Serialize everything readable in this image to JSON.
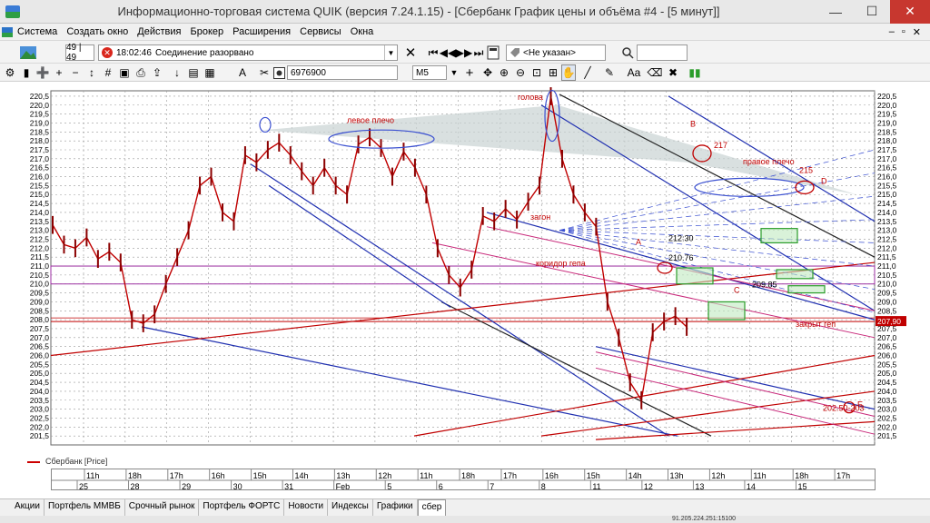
{
  "window": {
    "title": "Информационно-торговая система QUIK (версия 7.24.1.15) - [Сбербанк График цены и объёма #4 - [5 минут]]",
    "minimize": "—",
    "maximize": "☐",
    "close": "✕"
  },
  "menu": {
    "items": [
      "Система",
      "Создать окно",
      "Действия",
      "Брокер",
      "Расширения",
      "Сервисы",
      "Окна"
    ],
    "right": [
      "–",
      "▫",
      "✕"
    ]
  },
  "toolbar": {
    "counter": "49 | 49",
    "status_time": "18:02:46",
    "status_text": "Соединение разорвано",
    "close_symbol": "✕",
    "instrument_select": "<Не указан>",
    "security_code": "6976900",
    "timeframe": "M5"
  },
  "legend": {
    "label": "Сбербанк [Price]"
  },
  "chart_data": {
    "type": "candlestick",
    "title": "Сбербанк [Price]",
    "ylim": [
      201.0,
      220.8
    ],
    "y_ticks": [
      "220,5",
      "220,0",
      "219,5",
      "219,0",
      "218,5",
      "218,0",
      "217,5",
      "217,0",
      "216,5",
      "216,0",
      "215,5",
      "215,0",
      "214,5",
      "214,0",
      "213,5",
      "213,0",
      "212,5",
      "212,0",
      "211,5",
      "211,0",
      "210,5",
      "210,0",
      "209,5",
      "209,0",
      "208,5",
      "208,0",
      "207,5",
      "207,0",
      "206,5",
      "206,0",
      "205,5",
      "205,0",
      "204,5",
      "204,0",
      "203,5",
      "203,0",
      "202,5",
      "202,0",
      "201,5"
    ],
    "price_series": [
      [
        213.3,
        212.2,
        212.0,
        212.6,
        211.4,
        211.8,
        211.2,
        208.0,
        207.8,
        208.3,
        210.0,
        211.5,
        213.0,
        215.5,
        216.0,
        214.0,
        213.5,
        217.2,
        216.8,
        217.5,
        217.9,
        217.2,
        216.3,
        215.5,
        216.5,
        215.5,
        215.0,
        217.8,
        218.2,
        217.6,
        216.0,
        217.4,
        216.5,
        215.0,
        212.0,
        210.5,
        209.8,
        210.8,
        213.8,
        213.5,
        214.2,
        213.6,
        214.6,
        215.5,
        220.5,
        217.0,
        215.0,
        214.0,
        213.2,
        209.0,
        207.0,
        204.5,
        203.5,
        207.3,
        207.9,
        208.2,
        207.6
      ]
    ],
    "price_label_marker": "207,90",
    "time_row_1": [
      "11h",
      "18h",
      "17h",
      "16h",
      "15h",
      "14h",
      "13h",
      "12h",
      "11h",
      "18h",
      "17h",
      "16h",
      "15h",
      "14h",
      "13h",
      "12h",
      "11h",
      "18h",
      "17h"
    ],
    "time_row_2": [
      "25",
      "28",
      "29",
      "30",
      "31",
      "Feb",
      "5",
      "6",
      "7",
      "8",
      "11",
      "12",
      "13",
      "14",
      "15"
    ],
    "annotations": [
      {
        "text": "голова",
        "color": "#c00000"
      },
      {
        "text": "левое плечо",
        "color": "#c00000"
      },
      {
        "text": "правое плечо",
        "color": "#c00000"
      },
      {
        "text": "217",
        "color": "#c00000"
      },
      {
        "text": "215",
        "color": "#c00000"
      },
      {
        "text": "загон",
        "color": "#c00000"
      },
      {
        "text": "коридор гепа",
        "color": "#c00000"
      },
      {
        "text": "закрыт геп",
        "color": "#c00000"
      },
      {
        "text": "212:30",
        "color": "#000000"
      },
      {
        "text": "210.76",
        "color": "#000000"
      },
      {
        "text": "209.85",
        "color": "#000000"
      },
      {
        "text": "202.50-203",
        "color": "#c00000"
      },
      {
        "text": "A",
        "color": "#c00000"
      },
      {
        "text": "B",
        "color": "#c00000"
      },
      {
        "text": "C",
        "color": "#c00000"
      },
      {
        "text": "D",
        "color": "#c00000"
      },
      {
        "text": "E",
        "color": "#c00000"
      }
    ],
    "colors": {
      "candles": "#c00000",
      "blue_lines": "#1f2fb0",
      "red_lines": "#c00000",
      "magenta_lines": "#c8287a",
      "grid": "#888888"
    }
  },
  "tabs": [
    "Акции",
    "Портфель ММВБ",
    "Срочный рынок",
    "Портфель ФОРТС",
    "Новости",
    "Индексы",
    "Графики",
    "сбер"
  ],
  "active_tab": "сбер",
  "status": {
    "text": "91.205.224.251:15100"
  }
}
